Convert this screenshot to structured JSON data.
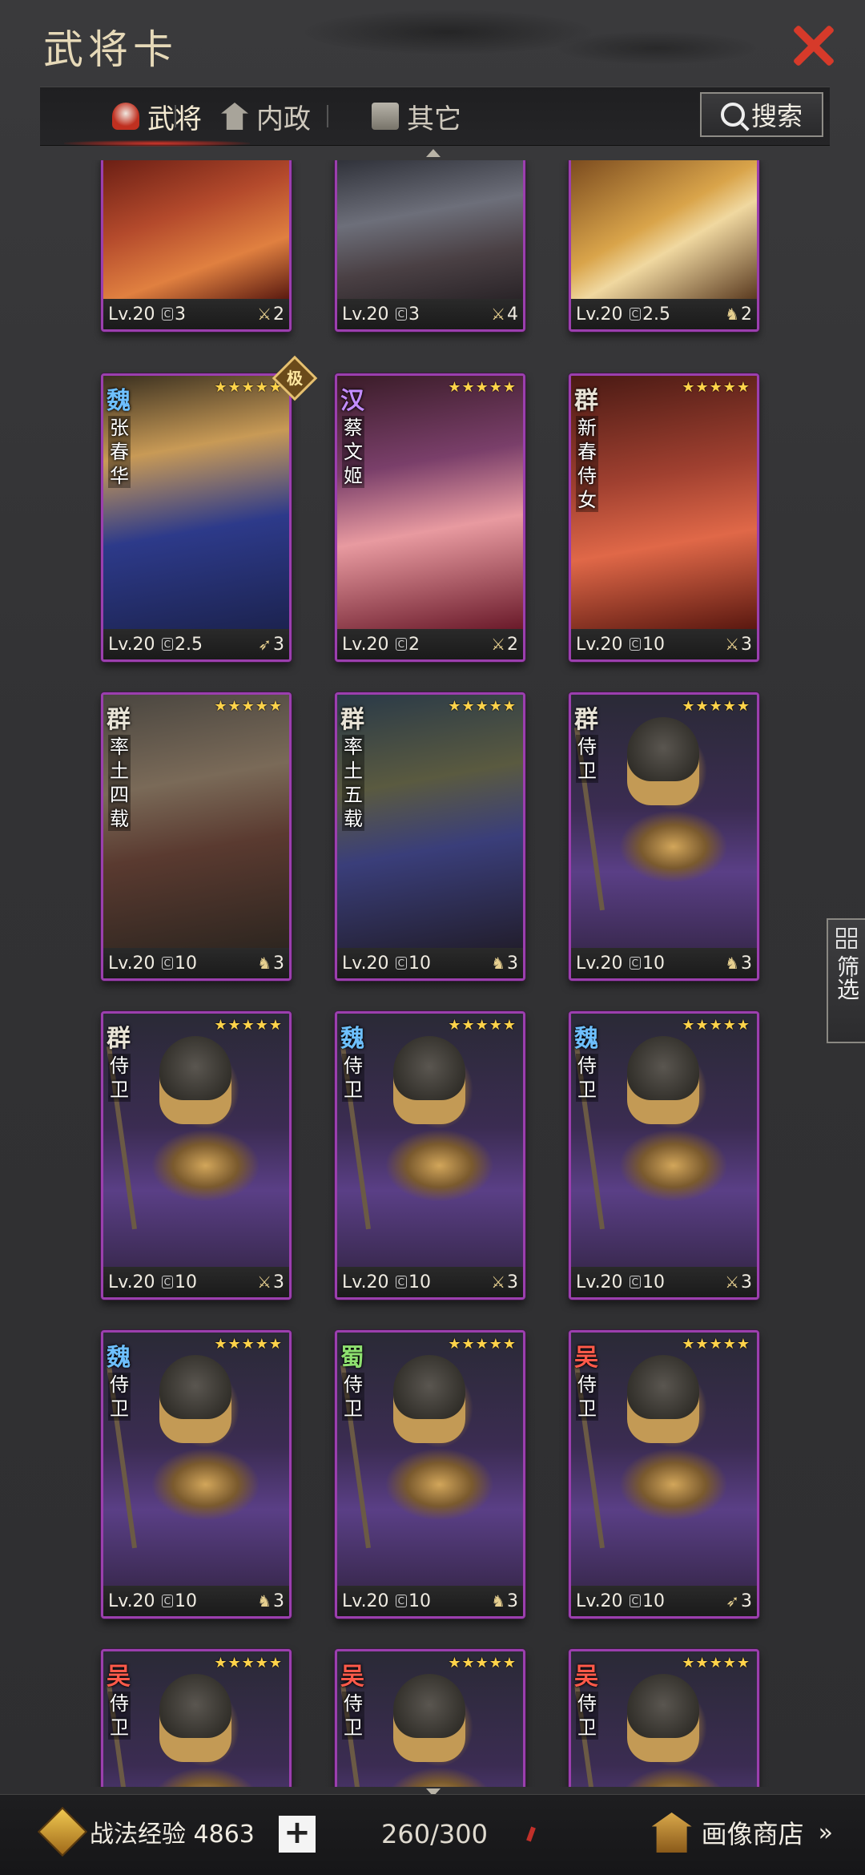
{
  "header": {
    "title": "武将卡"
  },
  "tabs": [
    {
      "label": "武将",
      "icon": "helmet-icon",
      "active": true
    },
    {
      "label": "内政",
      "icon": "temple-icon",
      "active": false
    },
    {
      "label": "其它",
      "icon": "chest-icon",
      "active": false
    }
  ],
  "search": {
    "label": "搜索"
  },
  "filter": {
    "label": "筛选"
  },
  "cards": [
    {
      "faction": "",
      "name": "",
      "level": "Lv.20",
      "cost": "3",
      "unit": "2",
      "unit_icon": "spear",
      "art": "red",
      "stars": "",
      "badge": ""
    },
    {
      "faction": "",
      "name": "",
      "level": "Lv.20",
      "cost": "3",
      "unit": "4",
      "unit_icon": "spear",
      "art": "dark",
      "stars": "",
      "badge": ""
    },
    {
      "faction": "",
      "name": "",
      "level": "Lv.20",
      "cost": "2.5",
      "unit": "2",
      "unit_icon": "horse",
      "art": "gold",
      "stars": "",
      "badge": ""
    },
    {
      "faction": "魏",
      "faction_key": "wei",
      "name": "张春华",
      "level": "Lv.20",
      "cost": "2.5",
      "unit": "3",
      "unit_icon": "bow",
      "art": "blue",
      "stars": "★★★★★",
      "badge": "极"
    },
    {
      "faction": "汉",
      "faction_key": "han",
      "name": "蔡文姬",
      "level": "Lv.20",
      "cost": "2",
      "unit": "2",
      "unit_icon": "spear",
      "art": "pink",
      "stars": "★★★★★",
      "badge": ""
    },
    {
      "faction": "群",
      "faction_key": "qun",
      "name": "新春侍女",
      "level": "Lv.20",
      "cost": "10",
      "unit": "3",
      "unit_icon": "spear",
      "art": "festive",
      "stars": "★★★★★",
      "badge": ""
    },
    {
      "faction": "群",
      "faction_key": "qun",
      "name": "率土四载",
      "level": "Lv.20",
      "cost": "10",
      "unit": "3",
      "unit_icon": "horse",
      "art": "battle",
      "stars": "★★★★★",
      "badge": ""
    },
    {
      "faction": "群",
      "faction_key": "qun",
      "name": "率土五载",
      "level": "Lv.20",
      "cost": "10",
      "unit": "3",
      "unit_icon": "horse",
      "art": "court",
      "stars": "★★★★★",
      "badge": ""
    },
    {
      "faction": "群",
      "faction_key": "qun",
      "name": "侍卫",
      "level": "Lv.20",
      "cost": "10",
      "unit": "3",
      "unit_icon": "horse",
      "art": "guard",
      "stars": "★★★★★",
      "badge": ""
    },
    {
      "faction": "群",
      "faction_key": "qun",
      "name": "侍卫",
      "level": "Lv.20",
      "cost": "10",
      "unit": "3",
      "unit_icon": "spear",
      "art": "guard",
      "stars": "★★★★★",
      "badge": ""
    },
    {
      "faction": "魏",
      "faction_key": "wei",
      "name": "侍卫",
      "level": "Lv.20",
      "cost": "10",
      "unit": "3",
      "unit_icon": "spear",
      "art": "guard",
      "stars": "★★★★★",
      "badge": ""
    },
    {
      "faction": "魏",
      "faction_key": "wei",
      "name": "侍卫",
      "level": "Lv.20",
      "cost": "10",
      "unit": "3",
      "unit_icon": "spear",
      "art": "guard",
      "stars": "★★★★★",
      "badge": ""
    },
    {
      "faction": "魏",
      "faction_key": "wei",
      "name": "侍卫",
      "level": "Lv.20",
      "cost": "10",
      "unit": "3",
      "unit_icon": "horse",
      "art": "guard",
      "stars": "★★★★★",
      "badge": ""
    },
    {
      "faction": "蜀",
      "faction_key": "shu",
      "name": "侍卫",
      "level": "Lv.20",
      "cost": "10",
      "unit": "3",
      "unit_icon": "horse",
      "art": "guard",
      "stars": "★★★★★",
      "badge": ""
    },
    {
      "faction": "吴",
      "faction_key": "wu",
      "name": "侍卫",
      "level": "Lv.20",
      "cost": "10",
      "unit": "3",
      "unit_icon": "bow",
      "art": "guard",
      "stars": "★★★★★",
      "badge": ""
    },
    {
      "faction": "吴",
      "faction_key": "wu",
      "name": "侍卫",
      "level": "",
      "cost": "",
      "unit": "",
      "unit_icon": "",
      "art": "guard",
      "stars": "★★★★★",
      "badge": ""
    },
    {
      "faction": "吴",
      "faction_key": "wu",
      "name": "侍卫",
      "level": "",
      "cost": "",
      "unit": "",
      "unit_icon": "",
      "art": "guard",
      "stars": "★★★★★",
      "badge": ""
    },
    {
      "faction": "吴",
      "faction_key": "wu",
      "name": "侍卫",
      "level": "",
      "cost": "",
      "unit": "",
      "unit_icon": "",
      "art": "guard",
      "stars": "★★★★★",
      "badge": ""
    }
  ],
  "footer": {
    "exp_label": "战法经验 4863",
    "plus": "+",
    "capacity": "260/300",
    "shop_label": "画像商店",
    "chevron": "»"
  }
}
